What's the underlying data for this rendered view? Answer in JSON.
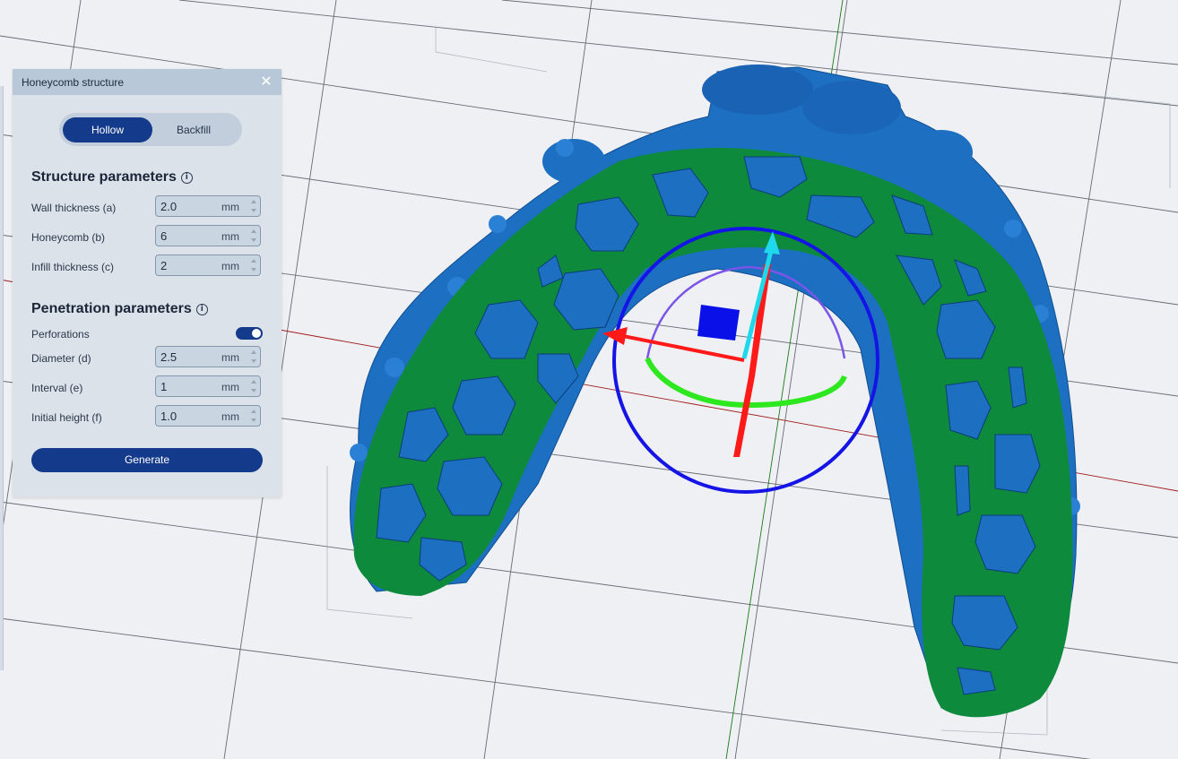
{
  "panel": {
    "title": "Honeycomb structure",
    "close_symbol": "✕",
    "mode_tabs": [
      {
        "label": "Hollow",
        "active": true
      },
      {
        "label": "Backfill",
        "active": false
      }
    ],
    "structure": {
      "title": "Structure parameters",
      "info_symbol": "i",
      "fields": [
        {
          "label": "Wall thickness (a)",
          "value": "2.0",
          "unit": "mm"
        },
        {
          "label": "Honeycomb  (b)",
          "value": "6",
          "unit": "mm"
        },
        {
          "label": "Infill thickness (c)",
          "value": "2",
          "unit": "mm"
        }
      ]
    },
    "penetration": {
      "title": "Penetration parameters",
      "info_symbol": "i",
      "perforations_label": "Perforations",
      "perforations_on": true,
      "fields": [
        {
          "label": "Diameter (d)",
          "value": "2.5",
          "unit": "mm"
        },
        {
          "label": "Interval (e)",
          "value": "1",
          "unit": "mm"
        },
        {
          "label": "Initial height (f)",
          "value": "1.0",
          "unit": "mm"
        }
      ]
    },
    "generate_label": "Generate"
  },
  "viewport": {
    "model_green": "#0e8a3c",
    "model_blue": "#1d6fc2",
    "gizmo_colors": {
      "x": "#ff1a1a",
      "y": "#2ee81f",
      "z": "#1ed8ec",
      "ring": "#1414e6",
      "arc": "#7a55e8"
    },
    "icons": [
      "translate-gizmo",
      "rotation-ring"
    ]
  }
}
